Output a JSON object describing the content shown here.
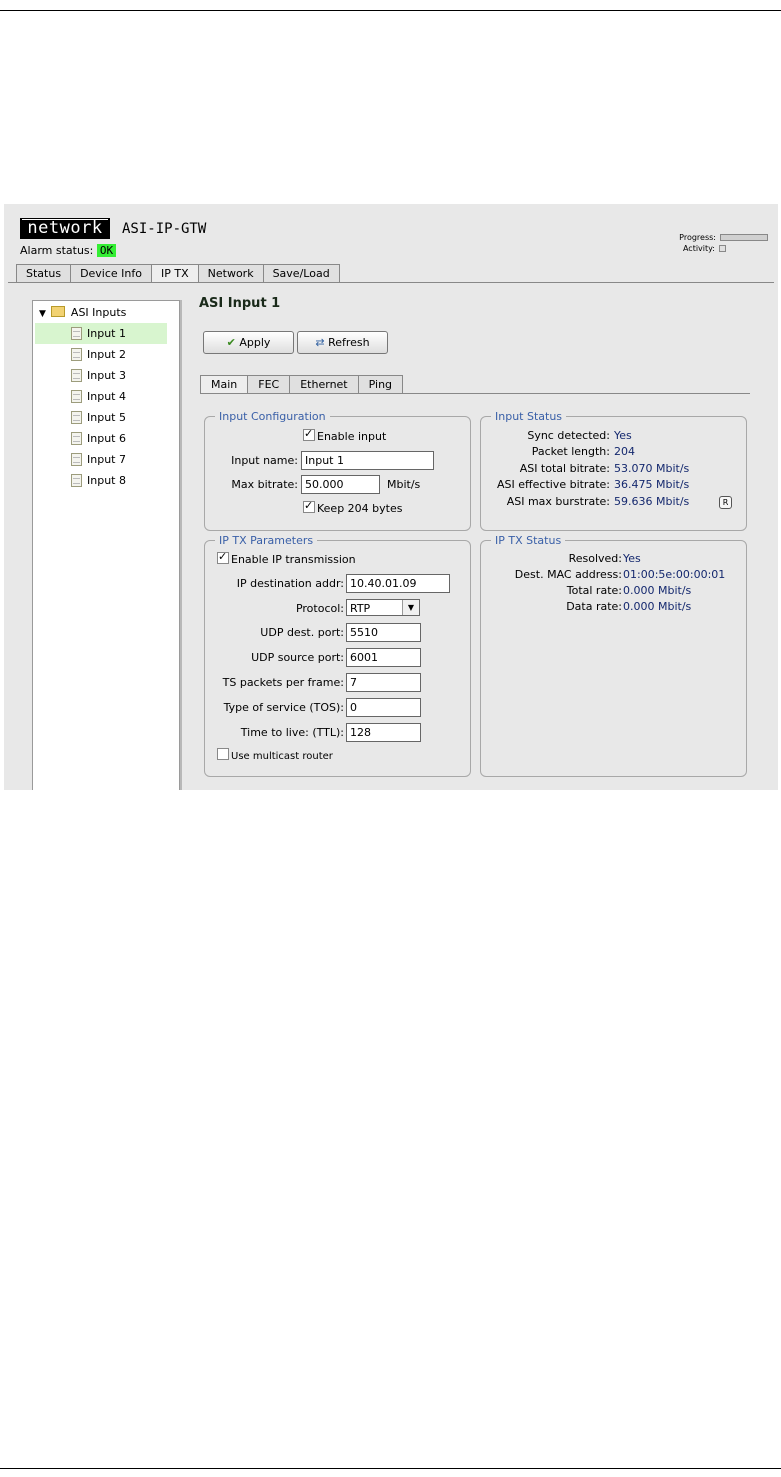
{
  "header": {
    "logo_text": "network",
    "device_name": "ASI-IP-GTW",
    "alarm_label": "Alarm status:",
    "alarm_value": "OK",
    "progress_label": "Progress:",
    "activity_label": "Activity:",
    "alarm_color": "#33ee33"
  },
  "main_tabs": [
    {
      "label": "Status"
    },
    {
      "label": "Device Info"
    },
    {
      "label": "IP TX",
      "active": true
    },
    {
      "label": "Network"
    },
    {
      "label": "Save/Load"
    }
  ],
  "tree": {
    "root_label": "ASI Inputs",
    "items": [
      {
        "label": "Input 1",
        "selected": true
      },
      {
        "label": "Input 2"
      },
      {
        "label": "Input 3"
      },
      {
        "label": "Input 4"
      },
      {
        "label": "Input 5"
      },
      {
        "label": "Input 6"
      },
      {
        "label": "Input 7"
      },
      {
        "label": "Input 8"
      }
    ]
  },
  "panel": {
    "title": "ASI Input 1",
    "apply_label": "Apply",
    "refresh_label": "Refresh"
  },
  "sub_tabs": [
    {
      "label": "Main",
      "active": true
    },
    {
      "label": "FEC"
    },
    {
      "label": "Ethernet"
    },
    {
      "label": "Ping"
    }
  ],
  "input_config": {
    "legend": "Input Configuration",
    "enable_input_label": "Enable input",
    "enable_input_checked": true,
    "input_name_label": "Input name:",
    "input_name_value": "Input 1",
    "max_bitrate_label": "Max bitrate:",
    "max_bitrate_value": "50.000",
    "max_bitrate_unit": "Mbit/s",
    "keep204_label": "Keep 204 bytes",
    "keep204_checked": true
  },
  "input_status": {
    "legend": "Input Status",
    "sync_label": "Sync detected:",
    "sync_value": "Yes",
    "packet_length_label": "Packet length:",
    "packet_length_value": "204",
    "total_bitrate_label": "ASI total bitrate:",
    "total_bitrate_value": "53.070 Mbit/s",
    "effective_bitrate_label": "ASI effective bitrate:",
    "effective_bitrate_value": "36.475 Mbit/s",
    "max_burstrate_label": "ASI max burstrate:",
    "max_burstrate_value": "59.636 Mbit/s",
    "reset_label": "R"
  },
  "iptx_params": {
    "legend": "IP TX Parameters",
    "enable_tx_label": "Enable IP transmission",
    "enable_tx_checked": true,
    "dest_addr_label": "IP destination addr:",
    "dest_addr_value": "10.40.01.09",
    "protocol_label": "Protocol:",
    "protocol_value": "RTP",
    "udp_dest_label": "UDP dest. port:",
    "udp_dest_value": "5510",
    "udp_src_label": "UDP source port:",
    "udp_src_value": "6001",
    "ts_packets_label": "TS packets per frame:",
    "ts_packets_value": "7",
    "tos_label": "Type of service (TOS):",
    "tos_value": "0",
    "ttl_label": "Time to live: (TTL):",
    "ttl_value": "128",
    "multicast_label": "Use multicast router",
    "multicast_checked": false
  },
  "iptx_status": {
    "legend": "IP TX Status",
    "resolved_label": "Resolved:",
    "resolved_value": "Yes",
    "mac_label": "Dest. MAC address:",
    "mac_value": "01:00:5e:00:00:01",
    "total_rate_label": "Total rate:",
    "total_rate_value": "0.000 Mbit/s",
    "data_rate_label": "Data rate:",
    "data_rate_value": "0.000 Mbit/s"
  }
}
